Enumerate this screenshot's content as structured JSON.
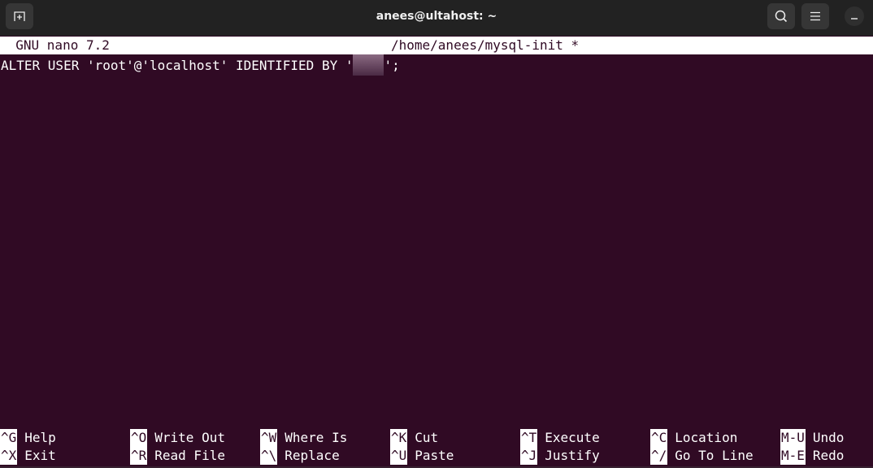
{
  "window": {
    "title": "anees@ultahost: ~",
    "buttons": {
      "new_tab": "new-tab-icon",
      "search": "search-icon",
      "menu": "hamburger-menu-icon",
      "minimize": "minimize-icon"
    }
  },
  "colors": {
    "terminal_bg": "#300a24",
    "titlebar_bg": "#222222",
    "header_bg": "#ffffff"
  },
  "nano": {
    "version_label": "  GNU nano 7.2",
    "file_label": "/home/anees/mysql-init *",
    "content": {
      "line1_before": "ALTER USER 'root'@'localhost' IDENTIFIED BY '",
      "line1_after": "';"
    },
    "shortcuts": [
      [
        {
          "key": "^G",
          "label": "Help"
        },
        {
          "key": "^O",
          "label": "Write Out"
        },
        {
          "key": "^W",
          "label": "Where Is"
        },
        {
          "key": "^K",
          "label": "Cut"
        },
        {
          "key": "^T",
          "label": "Execute"
        },
        {
          "key": "^C",
          "label": "Location"
        },
        {
          "key": "M-U",
          "label": "Undo"
        }
      ],
      [
        {
          "key": "^X",
          "label": "Exit"
        },
        {
          "key": "^R",
          "label": "Read File"
        },
        {
          "key": "^\\",
          "label": "Replace"
        },
        {
          "key": "^U",
          "label": "Paste"
        },
        {
          "key": "^J",
          "label": "Justify"
        },
        {
          "key": "^/",
          "label": "Go To Line"
        },
        {
          "key": "M-E",
          "label": "Redo"
        }
      ]
    ]
  }
}
